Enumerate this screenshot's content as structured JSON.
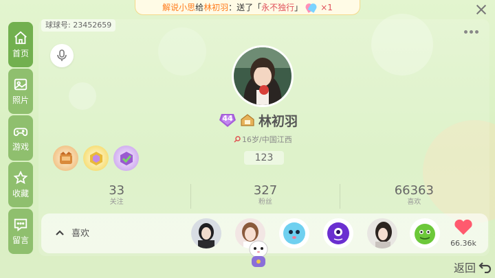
{
  "gift_banner": {
    "sender": "解说小思",
    "verb": "给",
    "receiver": "林初羽",
    "action": "：送了「",
    "gift_name": "永不独行",
    "close_quote": "」",
    "count": "×1"
  },
  "sidebar": {
    "items": [
      {
        "label": "首页",
        "icon": "home-icon",
        "active": true
      },
      {
        "label": "照片",
        "icon": "photo-icon",
        "active": false
      },
      {
        "label": "游戏",
        "icon": "gamepad-icon",
        "active": false
      },
      {
        "label": "收藏",
        "icon": "star-icon",
        "active": false
      },
      {
        "label": "留言",
        "icon": "message-icon",
        "active": false
      }
    ]
  },
  "profile": {
    "ball_id": "球球号: 23452659",
    "level": "44",
    "name": "林初羽",
    "location": "16岁/中国江西",
    "number": "123"
  },
  "stats": [
    {
      "value": "33",
      "label": "关注"
    },
    {
      "value": "327",
      "label": "粉丝"
    },
    {
      "value": "66363",
      "label": "喜欢"
    }
  ],
  "likes": {
    "label": "喜欢",
    "count": "66.36k"
  },
  "back_label": "返回",
  "colors": {
    "sidebar_bg": "#8fbf6e",
    "accent_orange": "#ff7a1a",
    "heart": "#ff5a6e"
  }
}
